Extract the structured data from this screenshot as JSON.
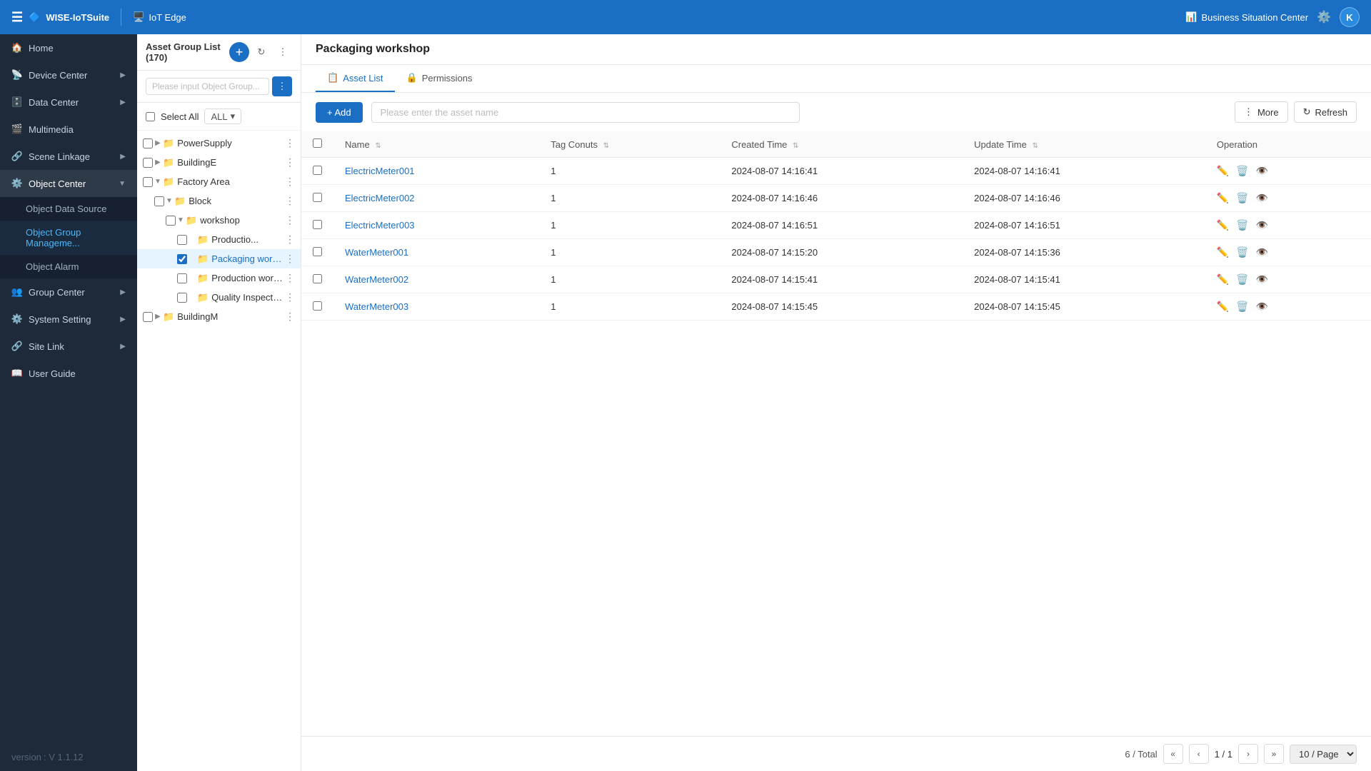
{
  "navbar": {
    "brand": "WISE-IoTSuite",
    "iotedge_label": "IoT Edge",
    "bsc_label": "Business Situation Center",
    "avatar_initials": "K"
  },
  "sidebar": {
    "items": [
      {
        "id": "home",
        "label": "Home",
        "icon": "🏠",
        "hasArrow": false
      },
      {
        "id": "device-center",
        "label": "Device Center",
        "icon": "📡",
        "hasArrow": true
      },
      {
        "id": "data-center",
        "label": "Data Center",
        "icon": "🗄️",
        "hasArrow": true
      },
      {
        "id": "multimedia",
        "label": "Multimedia",
        "icon": "🎬",
        "hasArrow": false
      },
      {
        "id": "scene-linkage",
        "label": "Scene Linkage",
        "icon": "🔗",
        "hasArrow": true
      },
      {
        "id": "object-center",
        "label": "Object Center",
        "icon": "⚙️",
        "hasArrow": true,
        "active": true
      }
    ],
    "submenu": [
      {
        "id": "object-data-source",
        "label": "Object Data Source"
      },
      {
        "id": "object-group-management",
        "label": "Object Group Manageme...",
        "active": true
      },
      {
        "id": "object-alarm",
        "label": "Object Alarm"
      }
    ],
    "bottom_items": [
      {
        "id": "group-center",
        "label": "Group Center",
        "icon": "👥",
        "hasArrow": true
      },
      {
        "id": "system-setting",
        "label": "System Setting",
        "icon": "⚙️",
        "hasArrow": true
      },
      {
        "id": "site-link",
        "label": "Site Link",
        "icon": "🔗",
        "hasArrow": true
      },
      {
        "id": "user-guide",
        "label": "User Guide",
        "icon": "📖",
        "hasArrow": false
      }
    ],
    "version_label": "version",
    "version_value": ": V 1.1.12"
  },
  "tree": {
    "title": "Asset Group List (170)",
    "search_placeholder": "Please input Object Group...",
    "select_all_label": "Select All",
    "select_all_badge": "ALL",
    "nodes": [
      {
        "id": "power-supply",
        "label": "PowerSupply",
        "indent": 0,
        "has_expand": true,
        "expanded": false
      },
      {
        "id": "buildinge",
        "label": "BuildingE",
        "indent": 0,
        "has_expand": true,
        "expanded": false
      },
      {
        "id": "factory-area",
        "label": "Factory Area",
        "indent": 0,
        "has_expand": true,
        "expanded": true
      },
      {
        "id": "block",
        "label": "Block",
        "indent": 1,
        "has_expand": true,
        "expanded": true
      },
      {
        "id": "workshop",
        "label": "workshop",
        "indent": 2,
        "has_expand": true,
        "expanded": true
      },
      {
        "id": "production-1",
        "label": "Productio...",
        "indent": 3,
        "has_expand": false,
        "expanded": false
      },
      {
        "id": "packaging-workshop",
        "label": "Packaging works...",
        "indent": 3,
        "has_expand": false,
        "expanded": false,
        "active": true
      },
      {
        "id": "production-workshop",
        "label": "Production worksh...",
        "indent": 3,
        "has_expand": false,
        "expanded": false
      },
      {
        "id": "quality-inspection",
        "label": "Quality Inspection ...",
        "indent": 3,
        "has_expand": false,
        "expanded": false
      },
      {
        "id": "buildingm",
        "label": "BuildingM",
        "indent": 0,
        "has_expand": true,
        "expanded": false
      }
    ]
  },
  "content": {
    "title": "Packaging workshop",
    "tabs": [
      {
        "id": "asset-list",
        "label": "Asset List",
        "icon": "📋",
        "active": true
      },
      {
        "id": "permissions",
        "label": "Permissions",
        "icon": "🔒",
        "active": false
      }
    ],
    "toolbar": {
      "add_label": "+ Add",
      "search_placeholder": "Please enter the asset name",
      "more_label": "More",
      "refresh_label": "Refresh"
    },
    "table": {
      "columns": [
        "Name",
        "Tag Conuts",
        "Created Time",
        "Update Time",
        "Operation"
      ],
      "rows": [
        {
          "id": "em001",
          "name": "ElectricMeter001",
          "tag_count": 1,
          "created": "2024-08-07 14:16:41",
          "updated": "2024-08-07 14:16:41"
        },
        {
          "id": "em002",
          "name": "ElectricMeter002",
          "tag_count": 1,
          "created": "2024-08-07 14:16:46",
          "updated": "2024-08-07 14:16:46"
        },
        {
          "id": "em003",
          "name": "ElectricMeter003",
          "tag_count": 1,
          "created": "2024-08-07 14:16:51",
          "updated": "2024-08-07 14:16:51"
        },
        {
          "id": "wm001",
          "name": "WaterMeter001",
          "tag_count": 1,
          "created": "2024-08-07 14:15:20",
          "updated": "2024-08-07 14:15:36"
        },
        {
          "id": "wm002",
          "name": "WaterMeter002",
          "tag_count": 1,
          "created": "2024-08-07 14:15:41",
          "updated": "2024-08-07 14:15:41"
        },
        {
          "id": "wm003",
          "name": "WaterMeter003",
          "tag_count": 1,
          "created": "2024-08-07 14:15:45",
          "updated": "2024-08-07 14:15:45"
        }
      ]
    },
    "pagination": {
      "total_label": "6 / Total",
      "page_info": "1 / 1",
      "page_size": "10 / Page"
    }
  }
}
